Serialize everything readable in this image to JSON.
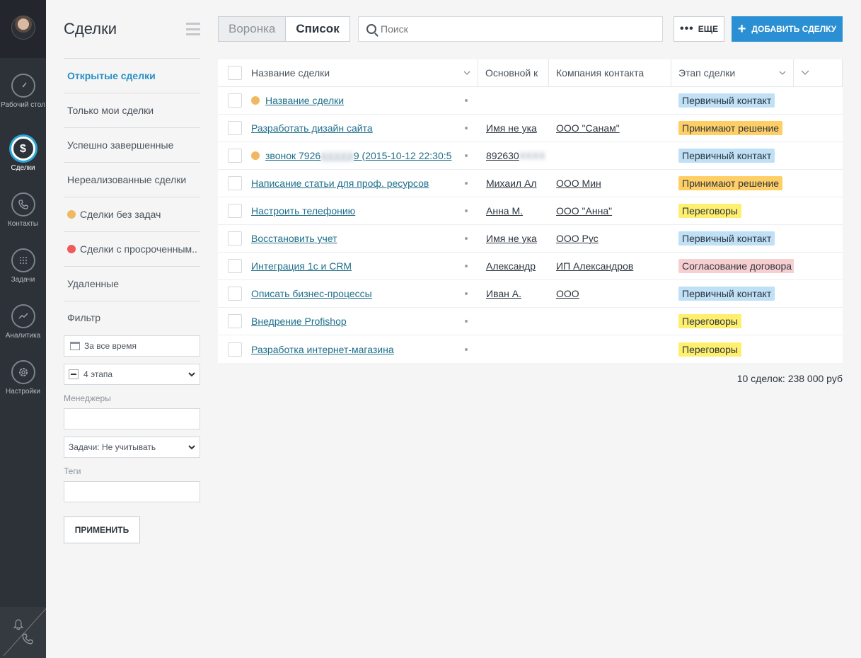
{
  "colors": {
    "accent": "#2a8fd3",
    "tag_primary_contact": "#bfe0f5",
    "tag_decision": "#ffcf66",
    "tag_negotiation": "#ffef6e",
    "tag_contract": "#f8cfd0",
    "dot_orange": "#f0b860",
    "dot_red": "#f05a5a"
  },
  "nav": {
    "items": [
      {
        "label": "Рабочий стол",
        "icon": "dashboard-icon"
      },
      {
        "label": "Сделки",
        "icon": "dollar-icon"
      },
      {
        "label": "Контакты",
        "icon": "phone-icon"
      },
      {
        "label": "Задачи",
        "icon": "tasks-icon"
      },
      {
        "label": "Аналитика",
        "icon": "analytics-icon"
      },
      {
        "label": "Настройки",
        "icon": "settings-icon"
      }
    ]
  },
  "page": {
    "title": "Сделки"
  },
  "sidebar": {
    "items": [
      {
        "label": "Открытые сделки"
      },
      {
        "label": "Только мои сделки"
      },
      {
        "label": "Успешно завершенные"
      },
      {
        "label": "Нереализованные сделки"
      },
      {
        "label": "Сделки без задач"
      },
      {
        "label": "Сделки с просроченным.."
      },
      {
        "label": "Удаленные"
      }
    ],
    "filter_label": "Фильтр",
    "date_value": "За все время",
    "stages_value": "4 этапа",
    "managers_label": "Менеджеры",
    "tasks_value": "Задачи: Не учитывать",
    "tags_label": "Теги",
    "apply_label": "ПРИМЕНИТЬ"
  },
  "toolbar": {
    "view_funnel": "Воронка",
    "view_list": "Список",
    "search_placeholder": "Поиск",
    "more_label": "ЕЩЕ",
    "add_label": "ДОБАВИТЬ СДЕЛКУ"
  },
  "table": {
    "columns": [
      "Название сделки",
      "Основной к",
      "Компания контакта",
      "Этап сделки"
    ],
    "rows": [
      {
        "name": "Название сделки",
        "dot": "orange",
        "contact": "",
        "company": "",
        "stage": "Первичный контакт",
        "stage_type": "primary"
      },
      {
        "name": "Разработать дизайн сайта",
        "dot": "",
        "contact": "Имя не ука",
        "company": "ООО \"Санам\"",
        "stage": "Принимают решение",
        "stage_type": "decision"
      },
      {
        "name": "звонок 7926",
        "name_blur": "XXXXX",
        "name_tail": "9 (2015-10-12 22:30:5",
        "dot": "orange",
        "contact": "892630",
        "contact_blur": "XXXX",
        "company": "",
        "stage": "Первичный контакт",
        "stage_type": "primary"
      },
      {
        "name": "Написание статьи для проф. ресурсов",
        "dot": "",
        "contact": "Михаил Ал",
        "company": "ООО Мин",
        "stage": "Принимают решение",
        "stage_type": "decision"
      },
      {
        "name": "Настроить телефонию",
        "dot": "",
        "contact": "Анна М.",
        "company": "ООО \"Анна\"",
        "stage": "Переговоры",
        "stage_type": "negotiation"
      },
      {
        "name": "Восстановить учет",
        "dot": "",
        "contact": "Имя не ука",
        "company": "ООО Рус",
        "stage": "Первичный контакт",
        "stage_type": "primary"
      },
      {
        "name": "Интеграция 1с и CRM",
        "dot": "",
        "contact": "Александр",
        "company": "ИП Александров",
        "stage": "Согласование договора",
        "stage_type": "contract"
      },
      {
        "name": "Описать бизнес-процессы",
        "dot": "",
        "contact": "Иван А.",
        "company": "ООО",
        "stage": "Первичный контакт",
        "stage_type": "primary"
      },
      {
        "name": "Внедрение Profishop",
        "dot": "",
        "contact": "",
        "company": "",
        "stage": "Переговоры",
        "stage_type": "negotiation"
      },
      {
        "name": "Разработка интернет-магазина",
        "dot": "",
        "contact": "",
        "company": "",
        "stage": "Переговоры",
        "stage_type": "negotiation"
      }
    ],
    "total": "10 сделок: 238 000 руб"
  }
}
